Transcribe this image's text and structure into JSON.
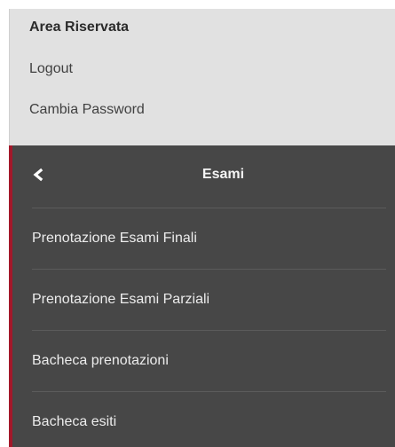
{
  "account": {
    "title": "Area Riservata",
    "logout": "Logout",
    "change_password": "Cambia Password"
  },
  "submenu": {
    "title": "Esami",
    "back_icon": "chevron-left-icon",
    "items": [
      {
        "label": "Prenotazione Esami Finali"
      },
      {
        "label": "Prenotazione Esami Parziali"
      },
      {
        "label": "Bacheca prenotazioni"
      },
      {
        "label": "Bacheca esiti"
      }
    ]
  },
  "colors": {
    "top_background": "#e1e1e1",
    "panel_background": "#474747",
    "accent": "#a3182a",
    "divider": "#5b5b5b"
  }
}
